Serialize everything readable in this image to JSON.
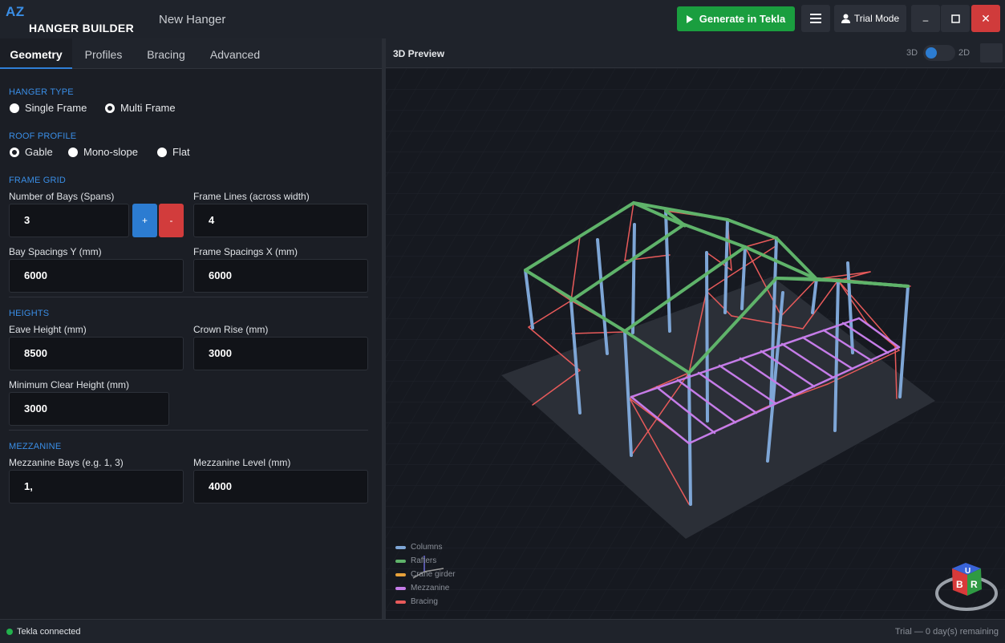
{
  "app": {
    "logo_short": "AZ",
    "logo_name": "HANGER BUILDER",
    "project_name": "New Hanger"
  },
  "toolbar": {
    "generate_label": "Generate in Tekla",
    "trial_label": "Trial Mode",
    "minimize_glyph": "–",
    "maximize_glyph": "☐",
    "close_glyph": "✕"
  },
  "tabs": [
    {
      "label": "Geometry",
      "active": true
    },
    {
      "label": "Profiles",
      "active": false
    },
    {
      "label": "Bracing",
      "active": false
    },
    {
      "label": "Advanced",
      "active": false
    }
  ],
  "geometry": {
    "hanger_type": {
      "title": "HANGER TYPE",
      "options": [
        {
          "label": "Single Frame",
          "checked": false
        },
        {
          "label": "Multi Frame",
          "checked": true
        }
      ]
    },
    "roof_profile": {
      "title": "ROOF PROFILE",
      "options": [
        {
          "label": "Gable",
          "checked": true
        },
        {
          "label": "Mono-slope",
          "checked": false
        },
        {
          "label": "Flat",
          "checked": false
        }
      ]
    },
    "frame_grid": {
      "title": "FRAME GRID",
      "bays_label": "Number of Bays (Spans)",
      "bays_value": "3",
      "plus_label": "+",
      "minus_label": "-",
      "frame_lines_label": "Frame Lines (across width)",
      "frame_lines_value": "4",
      "bay_spacing_label": "Bay Spacings Y (mm)",
      "bay_spacing_value": "6000",
      "frame_spacing_label": "Frame Spacings X (mm)",
      "frame_spacing_value": "6000"
    },
    "heights": {
      "title": "HEIGHTS",
      "eave_label": "Eave Height (mm)",
      "eave_value": "8500",
      "crown_label": "Crown Rise (mm)",
      "crown_value": "3000",
      "min_clear_label": "Minimum Clear Height (mm)",
      "min_clear_value": "3000"
    },
    "mezzanine": {
      "title": "MEZZANINE",
      "bays_label": "Mezzanine Bays (e.g. 1, 3)",
      "bays_value": "1,",
      "level_label": "Mezzanine Level (mm)",
      "level_value": "4000"
    }
  },
  "preview": {
    "title": "3D Preview",
    "toggle_left": "3D",
    "toggle_right": "2D",
    "mode": "3D",
    "legend": [
      {
        "label": "Columns",
        "color": "#7ea6d6"
      },
      {
        "label": "Rafters",
        "color": "#5fb36a"
      },
      {
        "label": "Crane girder",
        "color": "#e8a23a"
      },
      {
        "label": "Mezzanine",
        "color": "#c57ce8"
      },
      {
        "label": "Bracing",
        "color": "#e85a5a"
      }
    ],
    "view_cube": {
      "top": "U",
      "left": "B",
      "right": "R"
    }
  },
  "status": {
    "connection": "Tekla connected",
    "trial": "Trial — 0 day(s) remaining"
  }
}
